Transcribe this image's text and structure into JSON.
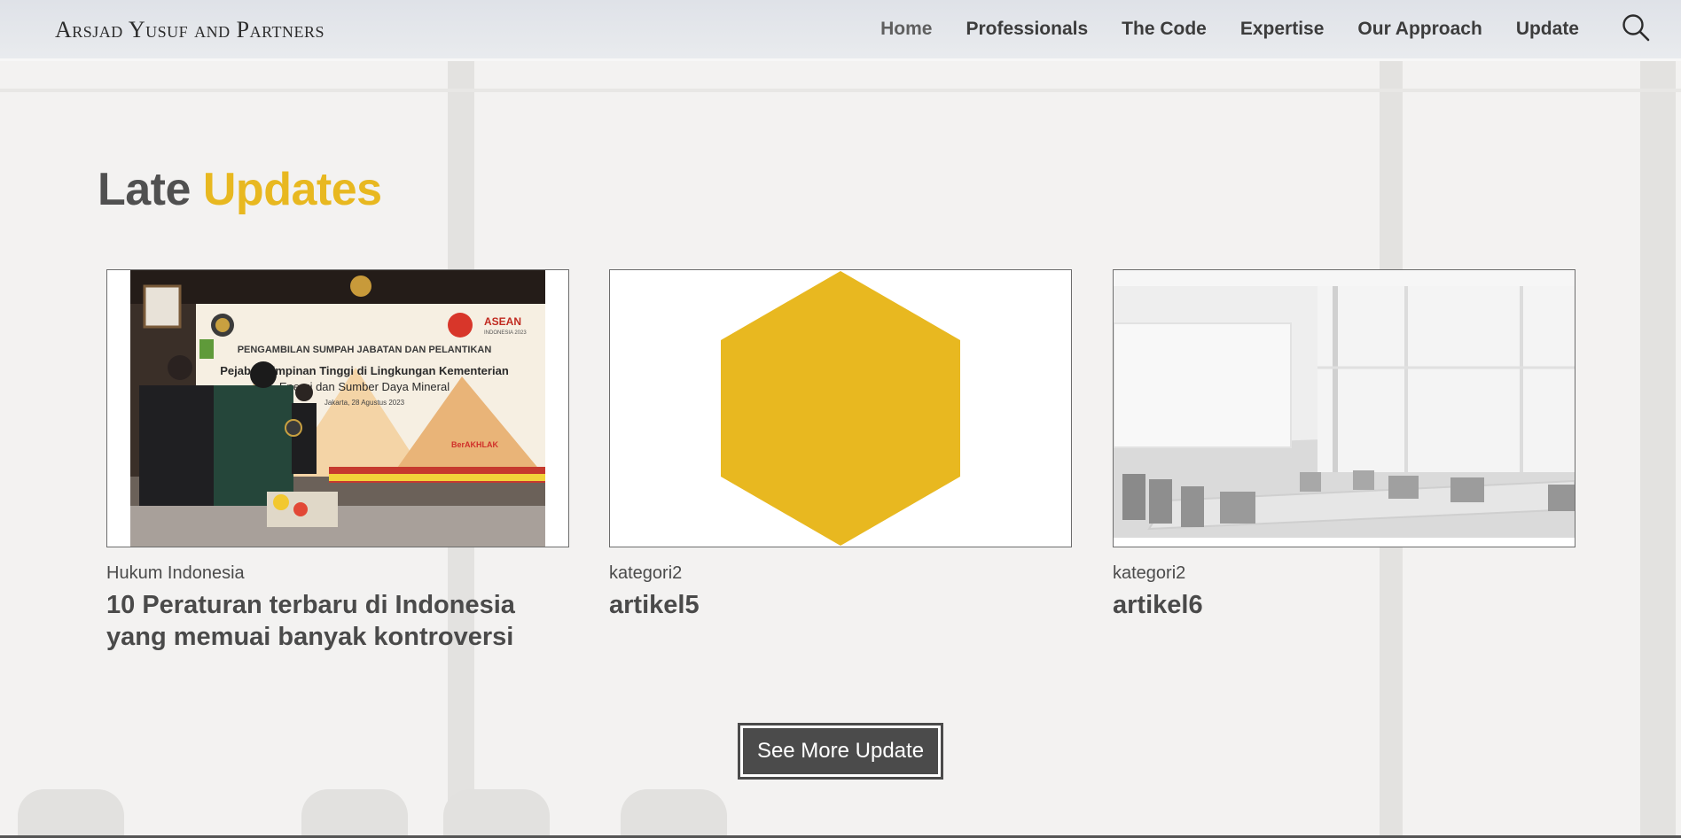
{
  "header": {
    "brand": "Arsjad Yusuf and Partners",
    "nav": [
      "Home",
      "Professionals",
      "The Code",
      "Expertise",
      "Our Approach",
      "Update"
    ],
    "search_icon": "search-icon"
  },
  "section": {
    "title_plain": "Late",
    "title_accent": "Updates"
  },
  "cards": [
    {
      "category": "Hukum Indonesia",
      "title": "10 Peraturan terbaru di Indonesia yang memuai banyak kontroversi",
      "image": {
        "banner_line1": "PENGAMBILAN SUMPAH JABATAN DAN PELANTIKAN",
        "banner_line2": "Pejabat Pimpinan Tinggi di Lingkungan Kementerian",
        "banner_line3": "Energi dan Sumber Daya Mineral",
        "banner_date": "Jakarta, 28 Agustus 2023",
        "logo_text": "ASEAN",
        "logo_sub": "INDONESIA 2023",
        "tag": "BerAKHLAK"
      }
    },
    {
      "category": "kategori2",
      "title": "artikel5",
      "image": {
        "shape": "hexagon",
        "color": "#E8B820"
      }
    },
    {
      "category": "kategori2",
      "title": "artikel6",
      "image": {
        "scene": "meeting-room"
      }
    }
  ],
  "cta": {
    "label": "See More Update"
  },
  "colors": {
    "accent": "#E8B820",
    "text": "#4A4A4A",
    "button": "#4B4B4B"
  }
}
